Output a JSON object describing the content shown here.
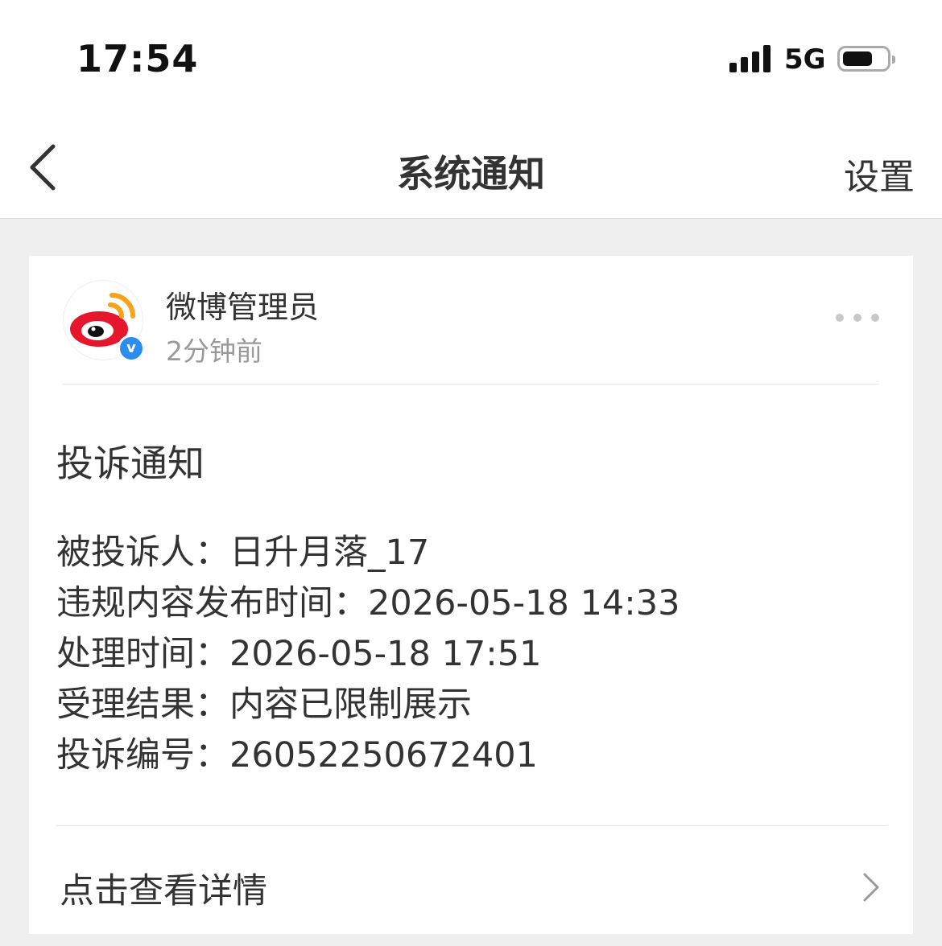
{
  "status_bar": {
    "time": "17:54",
    "network": "5G",
    "icons": [
      "signal-icon",
      "battery-icon"
    ]
  },
  "nav": {
    "back_icon": "chevron-left-icon",
    "title": "系统通知",
    "settings_label": "设置"
  },
  "message": {
    "sender_name": "微博管理员",
    "sent_time": "2分钟前",
    "verified_badge": "v",
    "more_icon": "more-dots-icon",
    "title": "投诉通知",
    "details": [
      "被投诉人：日升月落_17",
      "违规内容发布时间：2026-05-18 14:33",
      "处理时间：2026-05-18 17:51",
      "受理结果：内容已限制展示",
      "投诉编号：26052250672401"
    ],
    "action_label": "点击查看详情",
    "action_icon": "chevron-right-icon"
  },
  "colors": {
    "background": "#efefef",
    "card": "#ffffff",
    "text": "#333333",
    "muted": "#999999",
    "weibo_red": "#e6162d",
    "weibo_orange": "#f7a21b",
    "verified_blue": "#2d8cf0"
  }
}
